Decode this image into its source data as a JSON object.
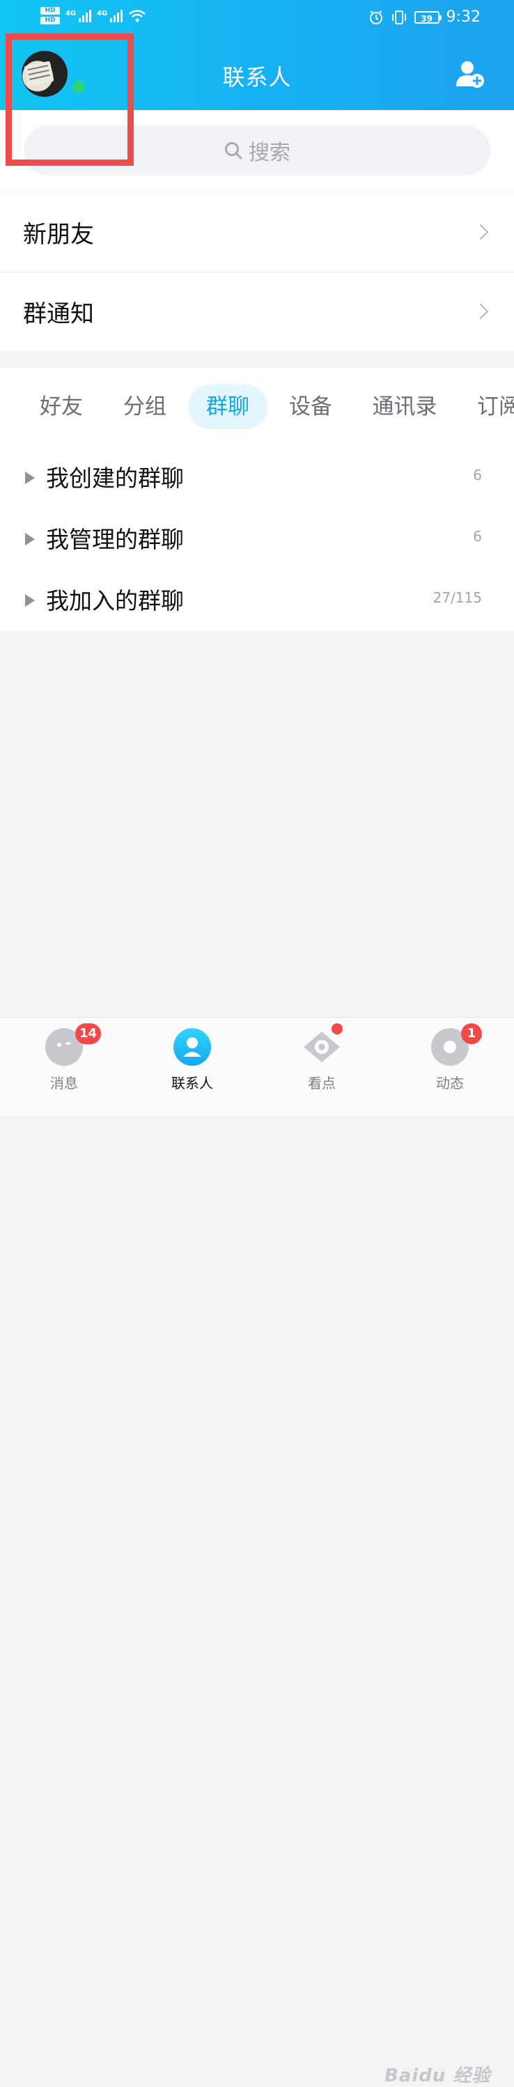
{
  "status_bar": {
    "hd_labels": [
      "HD",
      "HD"
    ],
    "network_labels": [
      "4G",
      "4G"
    ],
    "battery": "39",
    "time": "9:32"
  },
  "header": {
    "title": "联系人"
  },
  "search": {
    "placeholder": "搜索"
  },
  "menu": {
    "items": [
      {
        "label": "新朋友"
      },
      {
        "label": "群通知"
      }
    ]
  },
  "tabs": [
    {
      "label": "好友"
    },
    {
      "label": "分组"
    },
    {
      "label": "群聊"
    },
    {
      "label": "设备"
    },
    {
      "label": "通讯录"
    },
    {
      "label": "订阅"
    }
  ],
  "active_tab": "群聊",
  "groups": [
    {
      "label": "我创建的群聊",
      "count": "6"
    },
    {
      "label": "我管理的群聊",
      "count": "6"
    },
    {
      "label": "我加入的群聊",
      "count": "27/115"
    }
  ],
  "bottom_nav": [
    {
      "label": "消息",
      "badge": "14",
      "icon": "message-icon"
    },
    {
      "label": "联系人",
      "badge": "",
      "icon": "contacts-icon"
    },
    {
      "label": "看点",
      "badge": "",
      "icon": "eye-icon"
    },
    {
      "label": "动态",
      "badge": "1",
      "icon": "moments-icon"
    }
  ],
  "watermark": "Baidu 经验",
  "colors": {
    "header_start": "#12c6f4",
    "header_end": "#1ea3f0",
    "accent": "#14a7e0",
    "badge": "#f24848",
    "online": "#2bd67b",
    "highlight_box": "#ec4c4c"
  }
}
